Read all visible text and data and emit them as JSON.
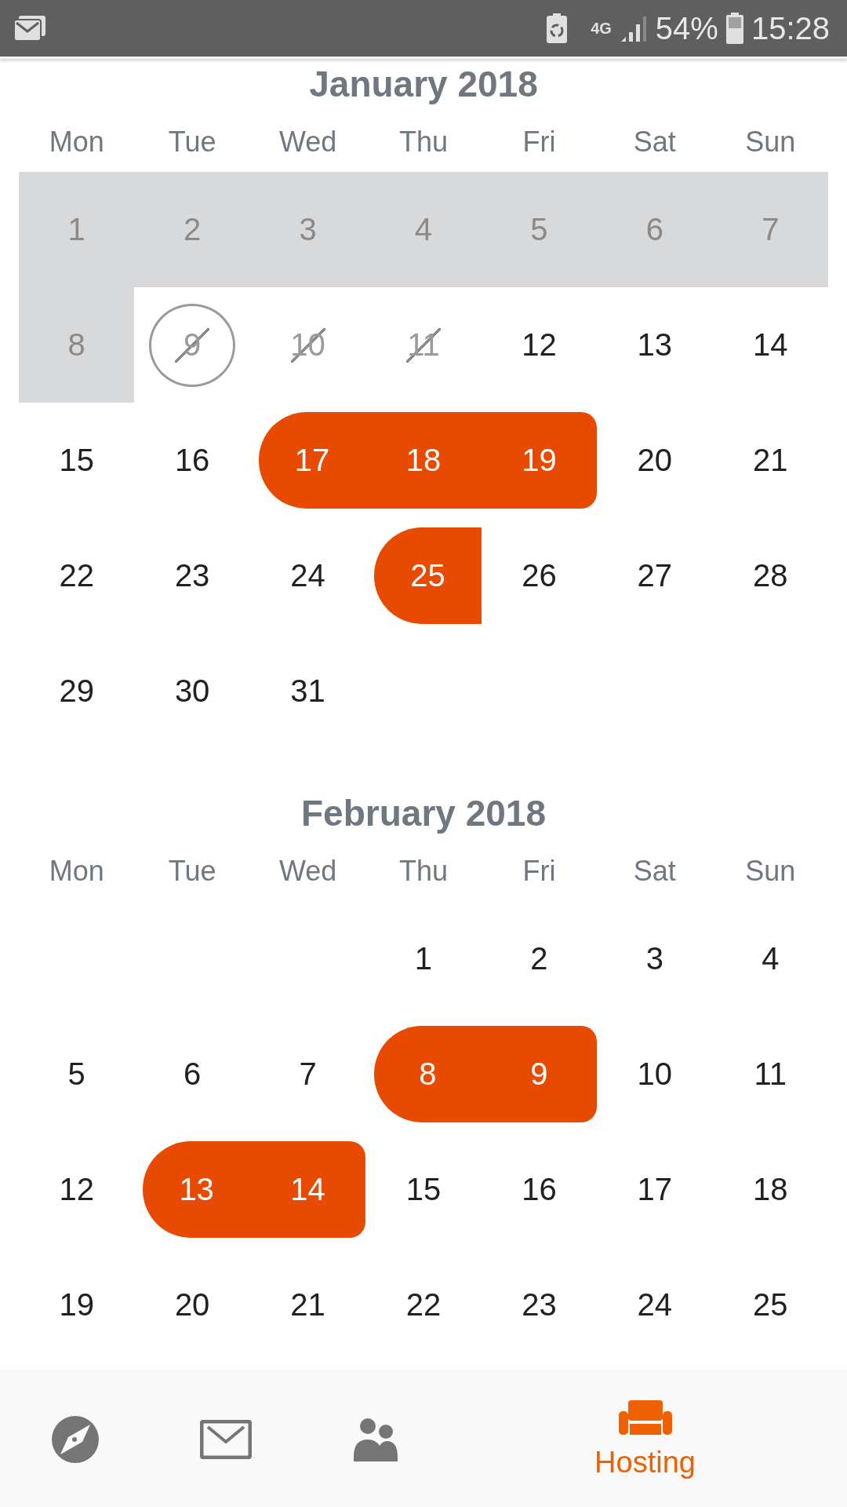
{
  "status_bar": {
    "network": "4G",
    "battery": "54%",
    "time": "15:28"
  },
  "months": [
    {
      "title": "January 2018",
      "weekdays": [
        "Mon",
        "Tue",
        "Wed",
        "Thu",
        "Fri",
        "Sat",
        "Sun"
      ],
      "days": [
        {
          "label": "1",
          "kind": "past"
        },
        {
          "label": "2",
          "kind": "past"
        },
        {
          "label": "3",
          "kind": "past"
        },
        {
          "label": "4",
          "kind": "past"
        },
        {
          "label": "5",
          "kind": "past"
        },
        {
          "label": "6",
          "kind": "past"
        },
        {
          "label": "7",
          "kind": "past"
        },
        {
          "label": "8",
          "kind": "past"
        },
        {
          "label": "9",
          "kind": "today-blocked"
        },
        {
          "label": "10",
          "kind": "blocked"
        },
        {
          "label": "11",
          "kind": "blocked"
        },
        {
          "label": "12",
          "kind": "free"
        },
        {
          "label": "13",
          "kind": "free"
        },
        {
          "label": "14",
          "kind": "free"
        },
        {
          "label": "15",
          "kind": "free"
        },
        {
          "label": "16",
          "kind": "free"
        },
        {
          "label": "17",
          "kind": "booked-start"
        },
        {
          "label": "18",
          "kind": "booked-middle"
        },
        {
          "label": "19",
          "kind": "booked-end"
        },
        {
          "label": "20",
          "kind": "free"
        },
        {
          "label": "21",
          "kind": "free"
        },
        {
          "label": "22",
          "kind": "free"
        },
        {
          "label": "23",
          "kind": "free"
        },
        {
          "label": "24",
          "kind": "free"
        },
        {
          "label": "25",
          "kind": "booked-start-open"
        },
        {
          "label": "26",
          "kind": "free"
        },
        {
          "label": "27",
          "kind": "free"
        },
        {
          "label": "28",
          "kind": "free"
        },
        {
          "label": "29",
          "kind": "free"
        },
        {
          "label": "30",
          "kind": "free"
        },
        {
          "label": "31",
          "kind": "free"
        }
      ]
    },
    {
      "title": "February 2018",
      "weekdays": [
        "Mon",
        "Tue",
        "Wed",
        "Thu",
        "Fri",
        "Sat",
        "Sun"
      ],
      "days": [
        {
          "kind": "blank"
        },
        {
          "kind": "blank"
        },
        {
          "kind": "blank"
        },
        {
          "label": "1",
          "kind": "free"
        },
        {
          "label": "2",
          "kind": "free"
        },
        {
          "label": "3",
          "kind": "free"
        },
        {
          "label": "4",
          "kind": "free"
        },
        {
          "label": "5",
          "kind": "free"
        },
        {
          "label": "6",
          "kind": "free"
        },
        {
          "label": "7",
          "kind": "free"
        },
        {
          "label": "8",
          "kind": "booked-start"
        },
        {
          "label": "9",
          "kind": "booked-end"
        },
        {
          "label": "10",
          "kind": "free"
        },
        {
          "label": "11",
          "kind": "free"
        },
        {
          "label": "12",
          "kind": "free"
        },
        {
          "label": "13",
          "kind": "booked-start"
        },
        {
          "label": "14",
          "kind": "booked-end"
        },
        {
          "label": "15",
          "kind": "free"
        },
        {
          "label": "16",
          "kind": "free"
        },
        {
          "label": "17",
          "kind": "free"
        },
        {
          "label": "18",
          "kind": "free"
        },
        {
          "label": "19",
          "kind": "free"
        },
        {
          "label": "20",
          "kind": "free"
        },
        {
          "label": "21",
          "kind": "free"
        },
        {
          "label": "22",
          "kind": "free"
        },
        {
          "label": "23",
          "kind": "free"
        },
        {
          "label": "24",
          "kind": "free"
        },
        {
          "label": "25",
          "kind": "free"
        }
      ]
    }
  ],
  "nav": [
    {
      "kind": "explore",
      "selected": false
    },
    {
      "kind": "inbox",
      "selected": false
    },
    {
      "kind": "people",
      "selected": false
    },
    {
      "kind": "hosting",
      "label": "Hosting",
      "selected": true
    }
  ]
}
